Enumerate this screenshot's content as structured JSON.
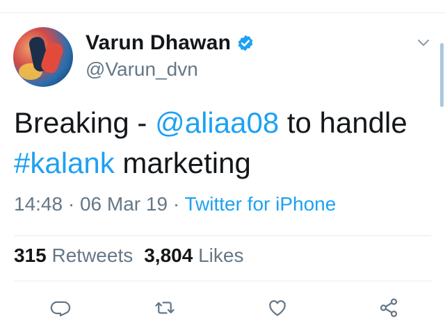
{
  "tweet": {
    "author_name": "Varun  Dhawan",
    "handle": "@Varun_dvn",
    "text_parts": {
      "p1": "Breaking - ",
      "mention": "@aliaa08",
      "p2": " to handle ",
      "hashtag": "#kalank",
      "p3": " marketing"
    },
    "time": "14:48",
    "date": "06 Mar 19",
    "separator": " · ",
    "source": "Twitter for iPhone",
    "retweets_count": "315",
    "retweets_label": "Retweets",
    "likes_count": "3,804",
    "likes_label": "Likes"
  },
  "icons": {
    "verified": "verified-badge-icon",
    "more": "chevron-down-icon",
    "reply": "reply-icon",
    "retweet": "retweet-icon",
    "like": "heart-icon",
    "share": "share-icon"
  },
  "colors": {
    "link": "#1da1f2",
    "secondary_text": "#657786",
    "primary_text": "#14171a"
  }
}
